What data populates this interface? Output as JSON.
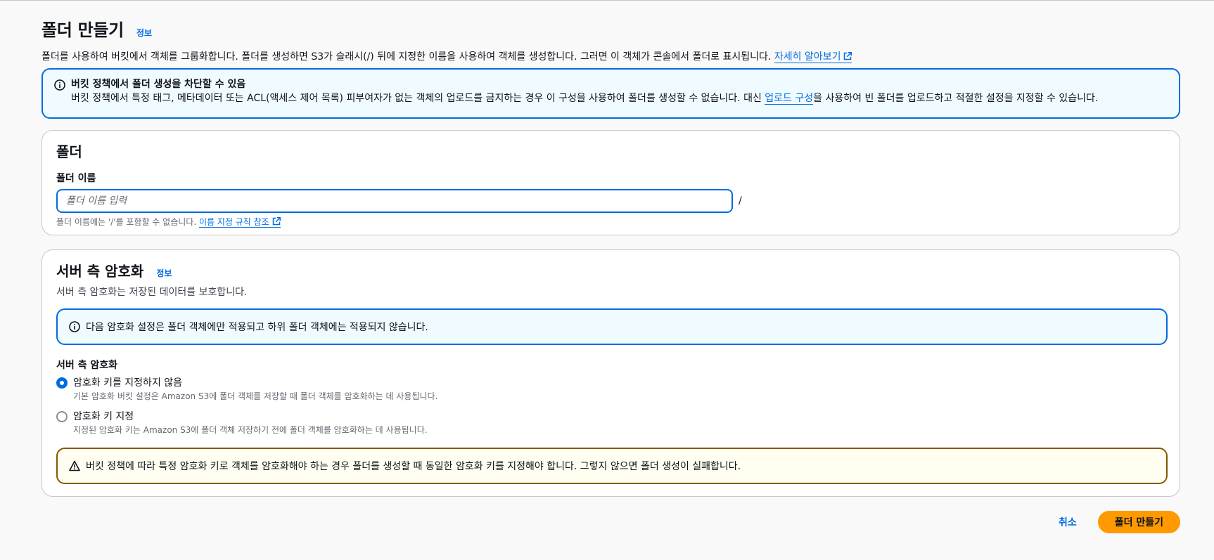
{
  "header": {
    "title": "폴더 만들기",
    "info": "정보",
    "description": "폴더를 사용하여 버킷에서 객체를 그룹화합니다. 폴더를 생성하면 S3가 슬래시(/) 뒤에 지정한 이름을 사용하여 객체를 생성합니다. 그러면 이 객체가 콘솔에서 폴더로 표시됩니다. ",
    "learn_more": "자세히 알아보기"
  },
  "policy_alert": {
    "title": "버킷 정책에서 폴더 생성을 차단할 수 있음",
    "body_before": "버킷 정책에서 특정 태그, 메타데이터 또는 ACL(액세스 제어 목록) 피부여자가 없는 객체의 업로드를 금지하는 경우 이 구성을 사용하여 폴더를 생성할 수 없습니다. 대신 ",
    "link": "업로드 구성",
    "body_after": "을 사용하여 빈 폴더를 업로드하고 적절한 설정을 지정할 수 있습니다."
  },
  "folder": {
    "title": "폴더",
    "name_label": "폴더 이름",
    "name_value": "",
    "name_placeholder": "폴더 이름 입력",
    "slash": "/",
    "constraint": "폴더 이름에는 '/'를 포함할 수 없습니다. ",
    "rules_link": "이름 지정 규칙 참조"
  },
  "encryption": {
    "title": "서버 측 암호화",
    "info": "정보",
    "description": "서버 측 암호화는 저장된 데이터를 보호합니다.",
    "notice": "다음 암호화 설정은 폴더 객체에만 적용되고 하위 폴더 객체에는 적용되지 않습니다.",
    "radio_label": "서버 측 암호화",
    "options": [
      {
        "label": "암호화 키를 지정하지 않음",
        "desc": "기본 암호화 버킷 설정은 Amazon S3에 폴더 객체를 저장할 때 폴더 객체를 암호화하는 데 사용됩니다.",
        "checked": true
      },
      {
        "label": "암호화 키 지정",
        "desc": "지정된 암호화 키는 Amazon S3에 폴더 객체 저장하기 전에 폴더 객체를 암호화하는 데 사용됩니다.",
        "checked": false
      }
    ],
    "warning": "버킷 정책에 따라 특정 암호화 키로 객체를 암호화해야 하는 경우 폴더를 생성할 때 동일한 암호화 키를 지정해야 합니다. 그렇지 않으면 폴더 생성이 실패합니다."
  },
  "footer": {
    "cancel": "취소",
    "submit": "폴더 만들기"
  },
  "colors": {
    "accent": "#006ce0",
    "primary_button": "#ff9900",
    "warning_border": "#855900",
    "info_background": "#f0fbff"
  }
}
